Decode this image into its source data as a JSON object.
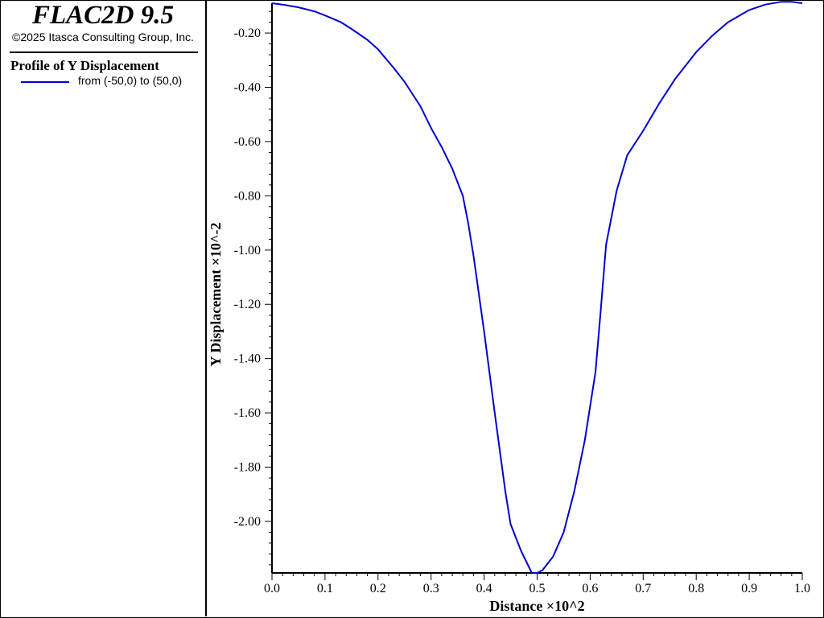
{
  "header": {
    "app_title": "FLAC2D 9.5",
    "copyright": "©2025 Itasca Consulting Group, Inc."
  },
  "legend": {
    "title": "Profile of Y Displacement",
    "entries": [
      {
        "label": "from (-50,0) to (50,0)",
        "color": "#0000cd"
      }
    ]
  },
  "chart_data": {
    "type": "line",
    "title": "Profile of Y Displacement",
    "xlabel": "Distance ×10^2",
    "ylabel": "Y Displacement ×10^-2",
    "xlim": [
      0.0,
      1.0
    ],
    "ylim": [
      -2.19,
      -0.09
    ],
    "grid": false,
    "legend_placement": "left panel",
    "x_ticks": [
      "0.0",
      "0.1",
      "0.2",
      "0.3",
      "0.4",
      "0.5",
      "0.6",
      "0.7",
      "0.8",
      "0.9",
      "1.0"
    ],
    "y_ticks": [
      "-0.20",
      "-0.40",
      "-0.60",
      "-0.80",
      "-1.00",
      "-1.20",
      "-1.40",
      "-1.60",
      "-1.80",
      "-2.00"
    ],
    "series": [
      {
        "name": "from (-50,0) to (50,0)",
        "color": "#0000cd",
        "x": [
          0.0,
          0.02,
          0.05,
          0.08,
          0.1,
          0.13,
          0.15,
          0.18,
          0.2,
          0.23,
          0.25,
          0.28,
          0.3,
          0.32,
          0.34,
          0.36,
          0.37,
          0.38,
          0.4,
          0.42,
          0.44,
          0.45,
          0.47,
          0.49,
          0.5,
          0.51,
          0.53,
          0.55,
          0.57,
          0.59,
          0.61,
          0.62,
          0.63,
          0.65,
          0.67,
          0.7,
          0.73,
          0.76,
          0.8,
          0.83,
          0.86,
          0.9,
          0.93,
          0.96,
          0.98,
          1.0
        ],
        "y": [
          -0.09,
          -0.095,
          -0.105,
          -0.12,
          -0.135,
          -0.16,
          -0.185,
          -0.225,
          -0.26,
          -0.33,
          -0.38,
          -0.47,
          -0.55,
          -0.62,
          -0.7,
          -0.8,
          -0.9,
          -1.02,
          -1.3,
          -1.6,
          -1.89,
          -2.01,
          -2.11,
          -2.19,
          -2.19,
          -2.18,
          -2.13,
          -2.04,
          -1.89,
          -1.7,
          -1.45,
          -1.22,
          -0.98,
          -0.78,
          -0.65,
          -0.56,
          -0.46,
          -0.37,
          -0.27,
          -0.21,
          -0.16,
          -0.115,
          -0.095,
          -0.085,
          -0.085,
          -0.09
        ]
      }
    ]
  }
}
